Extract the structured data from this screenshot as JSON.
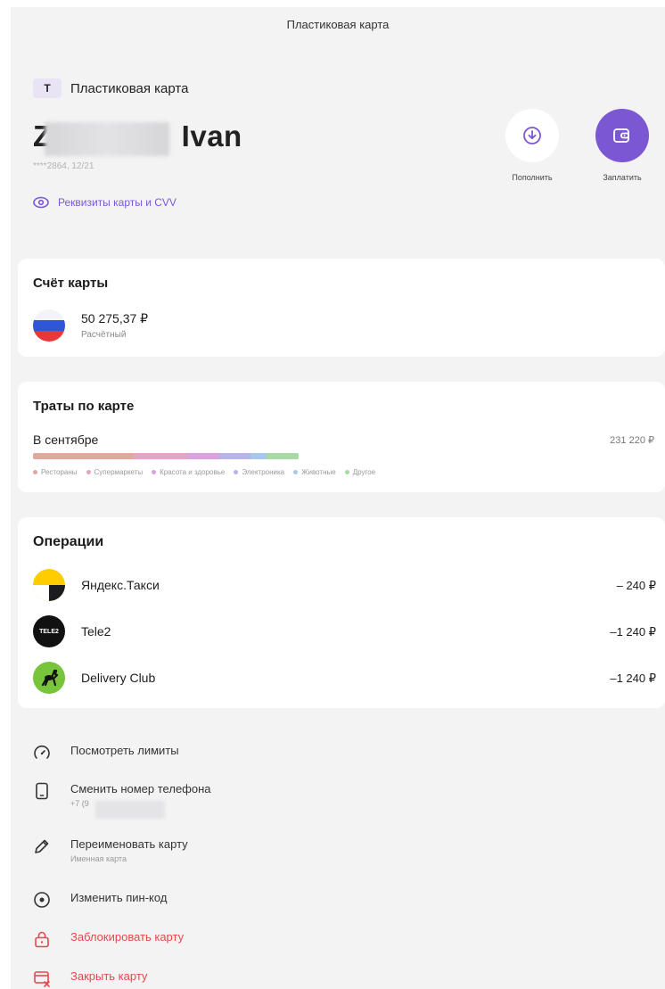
{
  "header": {
    "title": "Пластиковая карта"
  },
  "card": {
    "product_badge": "Т",
    "product_label": "Пластиковая карта",
    "name_initial": "Z",
    "name_suffix": "Ivan",
    "meta": "****2864, 12/21",
    "details_link": "Реквизиты карты и CVV"
  },
  "actions": [
    {
      "label": "Пополнить",
      "icon": "download-arrow-icon",
      "color": "#7b57d4"
    },
    {
      "label": "Заплатить",
      "icon": "wallet-icon",
      "color": "#7b57d4"
    }
  ],
  "account": {
    "title": "Счёт карты",
    "amount": "50 275,37 ₽",
    "type": "Расчётный",
    "icon": "russia-flag-icon"
  },
  "spending": {
    "title": "Траты по карте",
    "period": "В сентябре",
    "total": "231 220 ₽",
    "legend": [
      {
        "label": "Рестораны",
        "color": "#e3a89c",
        "share": 0.38
      },
      {
        "label": "Супермаркеты",
        "color": "#e8a3c4",
        "share": 0.2
      },
      {
        "label": "Красота и здоровье",
        "color": "#d9a1dd",
        "share": 0.12
      },
      {
        "label": "Электроника",
        "color": "#b6b4ea",
        "share": 0.12
      },
      {
        "label": "Животные",
        "color": "#a8c7ea",
        "share": 0.06
      },
      {
        "label": "Другое",
        "color": "#a9d9a6",
        "share": 0.12
      }
    ]
  },
  "operations": {
    "title": "Операции",
    "items": [
      {
        "name": "Яндекс.Такси",
        "amount": "– 240 ₽",
        "icon": "yandex-taxi-logo-icon"
      },
      {
        "name": "Tele2",
        "amount": "–1 240 ₽",
        "icon": "tele2-logo-icon",
        "logo_text": "TELE2"
      },
      {
        "name": "Delivery Club",
        "amount": "–1 240 ₽",
        "icon": "delivery-club-logo-icon"
      }
    ]
  },
  "menu": [
    {
      "label": "Посмотреть лимиты",
      "icon": "speedometer-icon"
    },
    {
      "label": "Сменить номер телефона",
      "sub": "+7 (9",
      "icon": "phone-icon"
    },
    {
      "label": "Переименовать карту",
      "sub": "Именная карта",
      "icon": "pencil-icon"
    },
    {
      "label": "Изменить пин-код",
      "icon": "pin-dot-icon"
    },
    {
      "label": "Заблокировать карту",
      "icon": "lock-icon",
      "danger": true
    },
    {
      "label": "Закрыть карту",
      "icon": "close-card-icon",
      "danger": true
    }
  ],
  "colors": {
    "accent": "#7b57d4",
    "danger": "#e5484d",
    "background": "#f3f3f4"
  }
}
